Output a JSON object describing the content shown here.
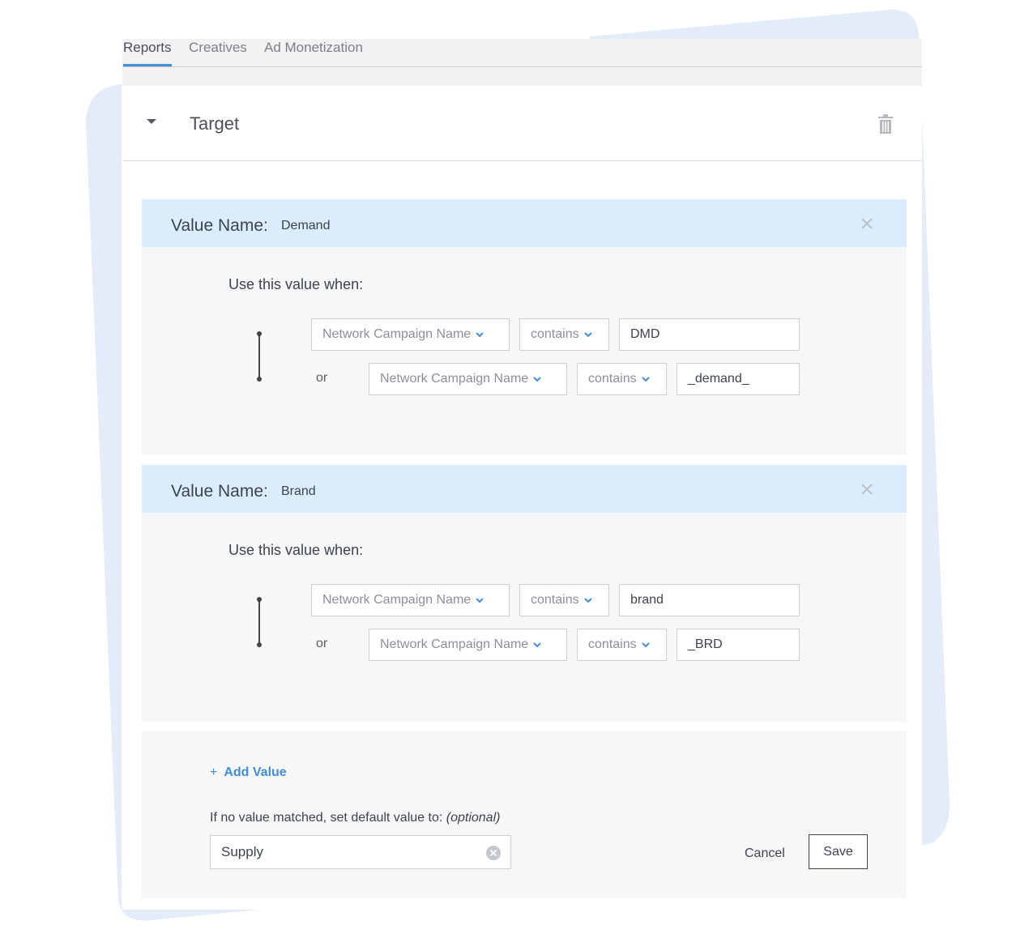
{
  "tabs": [
    {
      "label": "Reports",
      "active": true
    },
    {
      "label": "Creatives",
      "active": false
    },
    {
      "label": "Ad Monetization",
      "active": false
    }
  ],
  "target": {
    "title": "Target"
  },
  "value_name_label": "Value Name:",
  "use_when_label": "Use this value when:",
  "or_label": "or",
  "values": [
    {
      "name": "Demand",
      "conditions": [
        {
          "field": "Network Campaign Name",
          "operator": "contains",
          "value": "DMD"
        },
        {
          "field": "Network Campaign Name",
          "operator": "contains",
          "value": "_demand_"
        }
      ]
    },
    {
      "name": "Brand",
      "conditions": [
        {
          "field": "Network Campaign Name",
          "operator": "contains",
          "value": "brand"
        },
        {
          "field": "Network Campaign Name",
          "operator": "contains",
          "value": "_BRD"
        }
      ]
    }
  ],
  "footer": {
    "add_value_plus": "+",
    "add_value_label": "Add Value",
    "default_label": "If no value matched, set default value to:",
    "default_optional": "(optional)",
    "default_value": "Supply",
    "cancel_label": "Cancel",
    "save_label": "Save"
  },
  "colors": {
    "accent": "#3f8ede",
    "header_blue": "#dbedfc",
    "panel_gray": "#f7f7f7"
  }
}
